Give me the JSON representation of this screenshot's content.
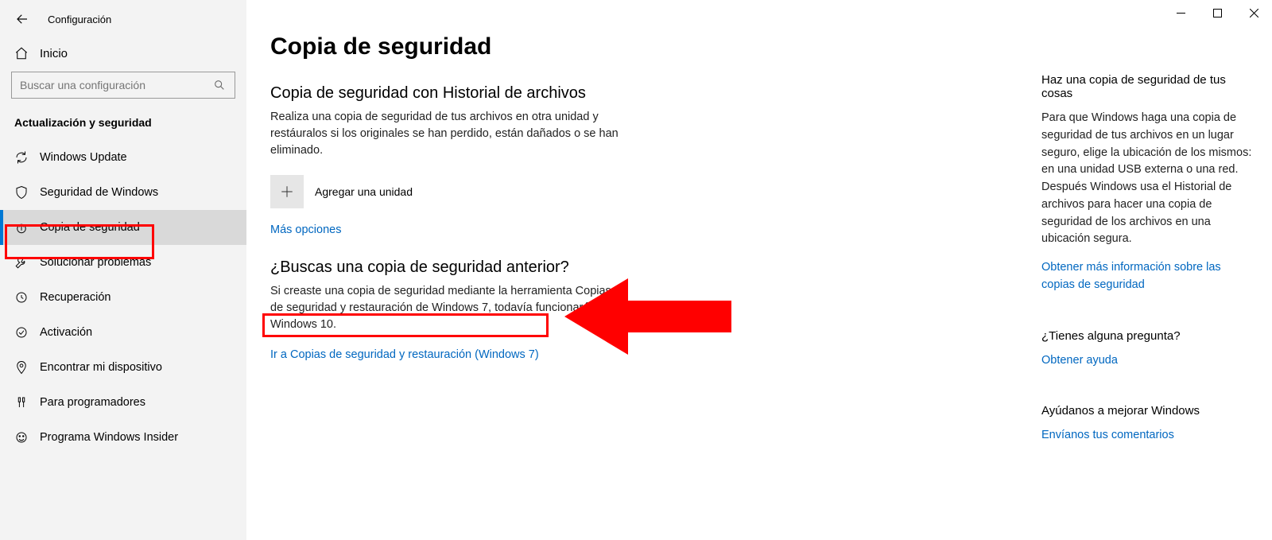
{
  "window": {
    "title": "Configuración"
  },
  "sidebar": {
    "home": "Inicio",
    "search_placeholder": "Buscar una configuración",
    "category": "Actualización y seguridad",
    "items": [
      {
        "label": "Windows Update",
        "icon": "sync"
      },
      {
        "label": "Seguridad de Windows",
        "icon": "shield"
      },
      {
        "label": "Copia de seguridad",
        "icon": "backup",
        "active": true
      },
      {
        "label": "Solucionar problemas",
        "icon": "wrench"
      },
      {
        "label": "Recuperación",
        "icon": "recovery"
      },
      {
        "label": "Activación",
        "icon": "activation"
      },
      {
        "label": "Encontrar mi dispositivo",
        "icon": "find"
      },
      {
        "label": "Para programadores",
        "icon": "dev"
      },
      {
        "label": "Programa Windows Insider",
        "icon": "insider"
      }
    ]
  },
  "page": {
    "title": "Copia de seguridad",
    "file_history": {
      "heading": "Copia de seguridad con Historial de archivos",
      "desc": "Realiza una copia de seguridad de tus archivos en otra unidad y restáuralos si los originales se han perdido, están dañados o se han eliminado.",
      "add_drive": "Agregar una unidad",
      "more_options": "Más opciones"
    },
    "previous_backup": {
      "heading": "¿Buscas una copia de seguridad anterior?",
      "desc": "Si creaste una copia de seguridad mediante la herramienta Copias de seguridad y restauración de Windows 7, todavía funcionará en Windows 10.",
      "link": "Ir a Copias de seguridad y restauración (Windows 7)"
    }
  },
  "aside": {
    "backup_tip": {
      "heading": "Haz una copia de seguridad de tus cosas",
      "desc": "Para que Windows haga una copia de seguridad de tus archivos en un lugar seguro, elige la ubicación de los mismos: en una unidad USB externa o una red. Después Windows usa el Historial de archivos para hacer una copia de seguridad de los archivos en una ubicación segura.",
      "link": "Obtener más información sobre las copias de seguridad"
    },
    "question": {
      "heading": "¿Tienes alguna pregunta?",
      "link": "Obtener ayuda"
    },
    "feedback": {
      "heading": "Ayúdanos a mejorar Windows",
      "link": "Envíanos tus comentarios"
    }
  }
}
